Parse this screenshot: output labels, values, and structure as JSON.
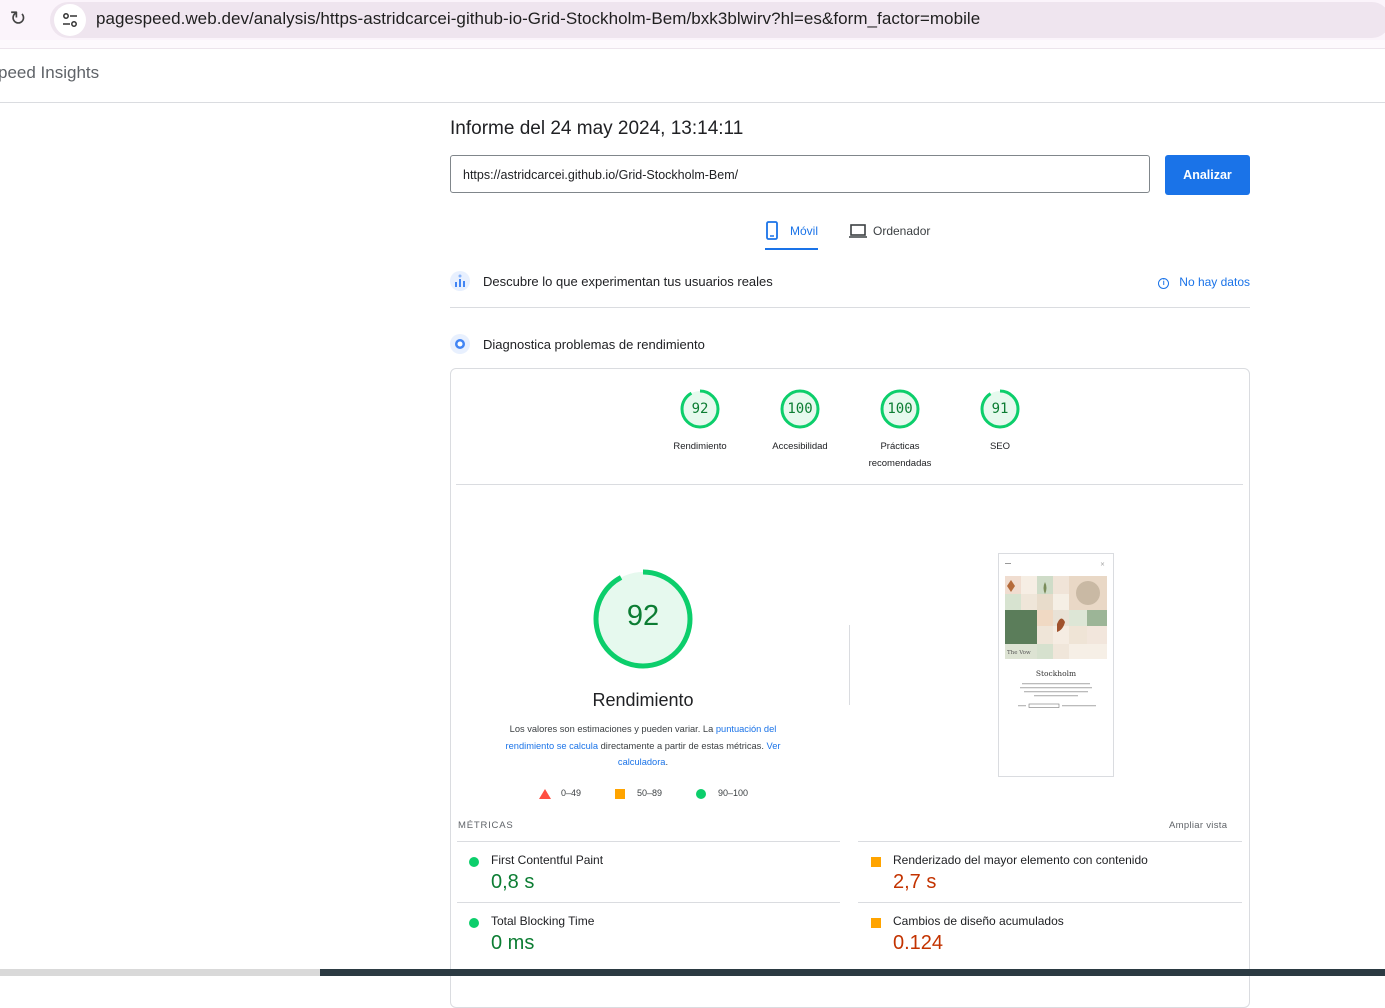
{
  "browser": {
    "reload_icon": "reload-icon",
    "site_info_icon": "tune-icon",
    "url": "pagespeed.web.dev/analysis/https-astridcarcei-github-io-Grid-Stockholm-Bem/bxk3blwirv?hl=es&form_factor=mobile"
  },
  "header": {
    "title": "peed Insights"
  },
  "report": {
    "title": "Informe del 24 may 2024, 13:14:11",
    "url_value": "https://astridcarcei.github.io/Grid-Stockholm-Bem/",
    "analyze_label": "Analizar"
  },
  "tabs": [
    {
      "label": "Móvil",
      "icon": "smartphone-icon",
      "active": true
    },
    {
      "label": "Ordenador",
      "icon": "laptop-icon",
      "active": false
    }
  ],
  "field_data": {
    "label": "Descubre lo que experimentan tus usuarios reales",
    "status": "No hay datos"
  },
  "lab_data": {
    "label": "Diagnostica problemas de rendimiento"
  },
  "categories": [
    {
      "score": "92",
      "label": "Rendimiento"
    },
    {
      "score": "100",
      "label": "Accesibilidad"
    },
    {
      "score": "100",
      "label": "Prácticas recomendadas"
    },
    {
      "score": "91",
      "label": "SEO"
    }
  ],
  "performance": {
    "score": "92",
    "title": "Rendimiento",
    "desc_1": "Los valores son estimaciones y pueden variar. La ",
    "desc_link_1": "puntuación del rendimiento se calcula",
    "desc_2": " directamente a partir de estas métricas. ",
    "desc_link_2": "Ver calculadora",
    "desc_3": "."
  },
  "legend": [
    {
      "range": "0–49",
      "color": "#f33"
    },
    {
      "range": "50–89",
      "color": "#fa3"
    },
    {
      "range": "90–100",
      "color": "#0c6"
    }
  ],
  "preview": {
    "heading": "Stockholm",
    "footer_text": "The Vow"
  },
  "metrics": {
    "label": "MÉTRICAS",
    "expand": "Ampliar vista",
    "items": [
      {
        "name": "First Contentful Paint",
        "value": "0,8 s",
        "rating": "good"
      },
      {
        "name": "Renderizado del mayor elemento con contenido",
        "value": "2,7 s",
        "rating": "average"
      },
      {
        "name": "Total Blocking Time",
        "value": "0 ms",
        "rating": "good"
      },
      {
        "name": "Cambios de diseño acumulados",
        "value": "0.124",
        "rating": "average"
      }
    ]
  },
  "colors": {
    "accent": "#1a73e8",
    "pass": "#0cce6b",
    "pass_text": "#0c7d33",
    "average": "#ffa400",
    "average_text": "#c33300",
    "fail": "#ff4e42"
  }
}
